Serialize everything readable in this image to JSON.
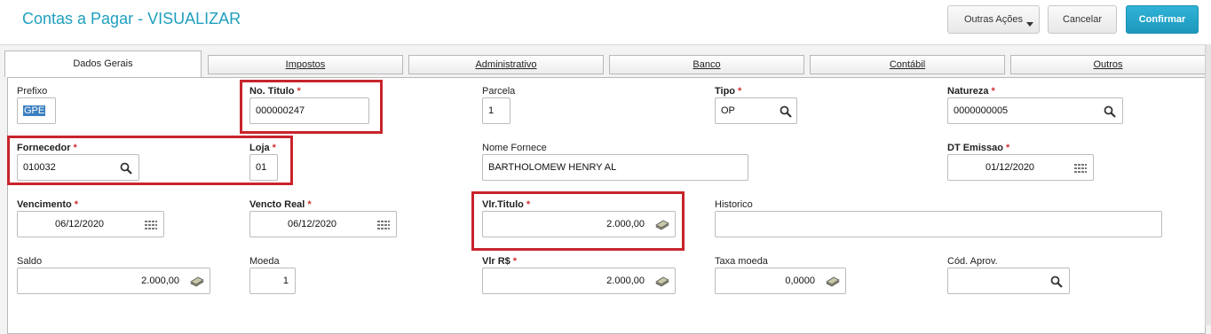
{
  "header": {
    "title": "Contas a Pagar - VISUALIZAR",
    "outras_acoes": "Outras Ações",
    "cancelar": "Cancelar",
    "confirmar": "Confirmar"
  },
  "tabs": [
    {
      "label": "Dados Gerais"
    },
    {
      "label": "Impostos"
    },
    {
      "label": "Administrativo"
    },
    {
      "label": "Banco"
    },
    {
      "label": "Contábil"
    },
    {
      "label": "Outros"
    }
  ],
  "form": {
    "prefixo": {
      "label": "Prefixo",
      "value": "GPE"
    },
    "no_titulo": {
      "label": "No. Titulo",
      "value": "000000247"
    },
    "parcela": {
      "label": "Parcela",
      "value": "1"
    },
    "tipo": {
      "label": "Tipo",
      "value": "OP"
    },
    "natureza": {
      "label": "Natureza",
      "value": "0000000005"
    },
    "fornecedor": {
      "label": "Fornecedor",
      "value": "010032"
    },
    "loja": {
      "label": "Loja",
      "value": "01"
    },
    "nome_fornece": {
      "label": "Nome Fornece",
      "value": "BARTHOLOMEW HENRY AL"
    },
    "dt_emissao": {
      "label": "DT Emissao",
      "value": "01/12/2020"
    },
    "vencimento": {
      "label": "Vencimento",
      "value": "06/12/2020"
    },
    "vencto_real": {
      "label": "Vencto Real",
      "value": "06/12/2020"
    },
    "vlr_titulo": {
      "label": "Vlr.Titulo",
      "value": "2.000,00"
    },
    "historico": {
      "label": "Historico",
      "value": ""
    },
    "saldo": {
      "label": "Saldo",
      "value": "2.000,00"
    },
    "moeda": {
      "label": "Moeda",
      "value": "1"
    },
    "vlr_rs": {
      "label": "Vlr R$",
      "value": "2.000,00"
    },
    "taxa_moeda": {
      "label": "Taxa moeda",
      "value": "0,0000"
    },
    "cod_aprov": {
      "label": "Cód. Aprov.",
      "value": ""
    }
  },
  "required_mark": "*",
  "colors": {
    "title": "#1f9fbf",
    "confirm": "#1d98bd",
    "required": "#d03030",
    "highlight": "#c8242c"
  },
  "icons": [
    "search-icon",
    "calendar-icon",
    "money-icon",
    "caret-down-icon"
  ]
}
